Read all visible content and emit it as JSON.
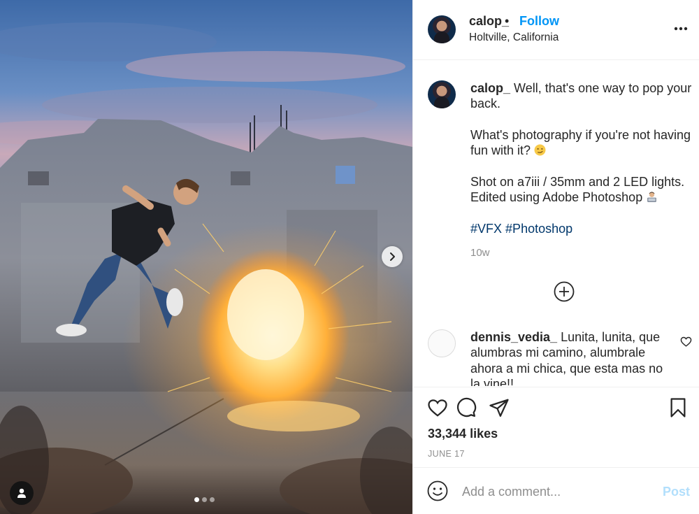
{
  "post": {
    "username": "calop_",
    "separator": "•",
    "follow_label": "Follow",
    "location": "Holtville, California"
  },
  "caption": {
    "username": "calop_",
    "line1": "Well, that's one way to pop your back.",
    "line2": "What's photography if you're not having fun with it?",
    "line3a": "Shot on a7iii / 35mm and 2 LED lights.",
    "line3b": "Edited using Adobe Photoshop",
    "hashtag1": "#VFX",
    "hashtag2": "#Photoshop",
    "time": "10w"
  },
  "comments": [
    {
      "username": "dennis_vedia_",
      "text": "Lunita, lunita, que alumbras mi camino, alumbrale ahora a mi chica, que esta mas no la vine!!"
    }
  ],
  "stats": {
    "likes_count": "33,344",
    "likes_label": "likes",
    "date": "JUNE 17"
  },
  "comment_box": {
    "placeholder": "Add a comment...",
    "post_label": "Post"
  },
  "carousel": {
    "total_slides": 3,
    "active_slide": 1
  },
  "colors": {
    "accent_blue": "#0095f6",
    "post_disabled": "#b2dffc",
    "hashtag": "#00376b",
    "muted_text": "#8e8e8e"
  },
  "icons": [
    "more-options-icon",
    "chevron-right-icon",
    "user-tag-icon",
    "plus-circle-icon",
    "heart-icon",
    "comment-icon",
    "share-icon",
    "bookmark-icon",
    "smile-icon"
  ]
}
